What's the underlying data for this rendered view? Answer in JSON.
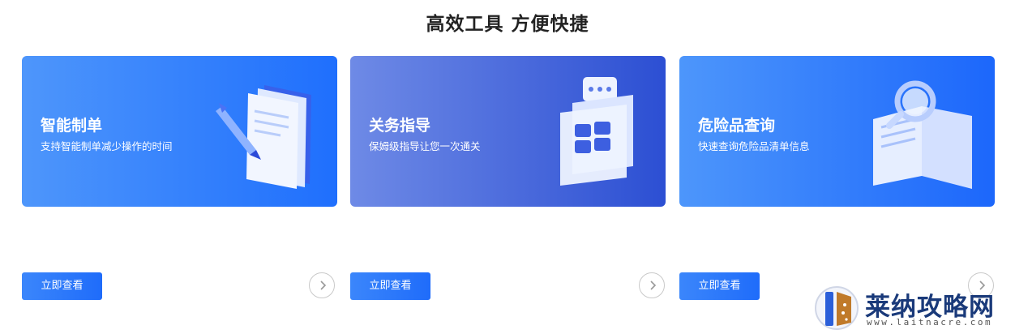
{
  "section": {
    "title": "高效工具 方便快捷"
  },
  "cards": [
    {
      "title": "智能制单",
      "description": "支持智能制单减少操作的时间",
      "illustration": "document-pen-icon",
      "button_label": "立即查看"
    },
    {
      "title": "关务指导",
      "description": "保姆级指导让您一次通关",
      "illustration": "chat-window-icon",
      "button_label": "立即查看"
    },
    {
      "title": "危险品查询",
      "description": "快速查询危险品清单信息",
      "illustration": "book-magnifier-icon",
      "button_label": "立即查看"
    }
  ],
  "watermark": {
    "name": "莱纳攻略网",
    "url": "www.laitnacre.com"
  },
  "icons": {
    "arrow": "chevron-right-icon"
  },
  "colors": {
    "accent": "#1f6ffd",
    "title": "#222222",
    "button": "#2a78fa"
  }
}
